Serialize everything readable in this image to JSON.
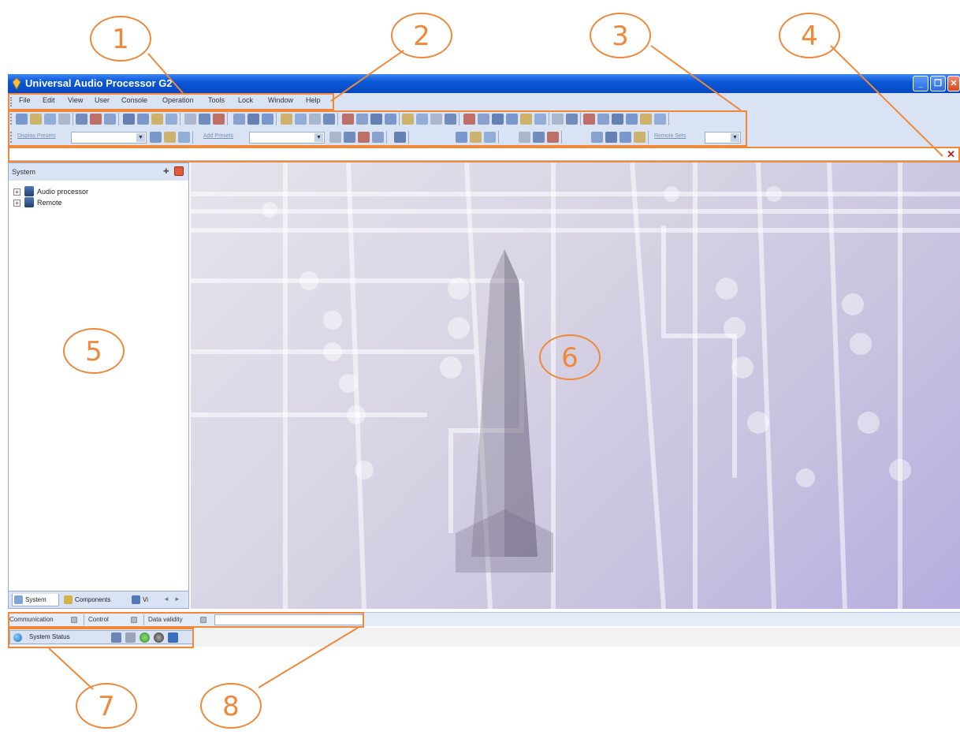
{
  "window": {
    "title": "Universal Audio Processor G2"
  },
  "menu": {
    "items": [
      "File",
      "Edit",
      "View",
      "User",
      "Console",
      "Operation",
      "Tools",
      "Lock",
      "Window",
      "Help"
    ]
  },
  "toolbar2": {
    "label_left": "Display Presets",
    "label_mid": "Add Presets",
    "label_right": "Remote Sets"
  },
  "left_panel": {
    "title": "System",
    "tree": [
      {
        "label": "Audio processor",
        "expander": "+"
      },
      {
        "label": "Remote",
        "expander": "+"
      }
    ],
    "tabs": [
      {
        "label": "System"
      },
      {
        "label": "Components"
      },
      {
        "label": "Vi"
      }
    ]
  },
  "status_bar": {
    "communication": "Communication",
    "control": "Control",
    "data_validity": "Data validity"
  },
  "system_status": {
    "label": "System Status"
  },
  "annotations": [
    {
      "number": "1"
    },
    {
      "number": "2"
    },
    {
      "number": "3"
    },
    {
      "number": "4"
    },
    {
      "number": "5"
    },
    {
      "number": "6"
    },
    {
      "number": "7"
    },
    {
      "number": "8"
    }
  ],
  "colors": {
    "annotation": "#f0883a",
    "titlebar": "#0a58d8",
    "chrome": "#d9e3f4"
  }
}
